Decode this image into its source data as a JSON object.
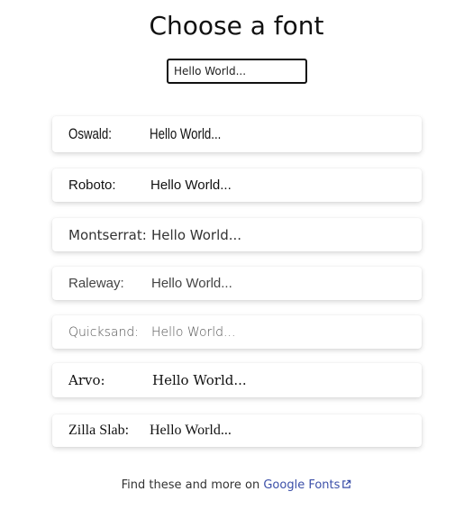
{
  "header": {
    "title": "Choose a font"
  },
  "preview_input": {
    "value": "Hello World..."
  },
  "fonts": [
    {
      "name": "Oswald:",
      "sample": "Hello World..."
    },
    {
      "name": "Roboto:",
      "sample": "Hello World..."
    },
    {
      "name": "Montserrat:",
      "sample": "Hello World..."
    },
    {
      "name": "Raleway:",
      "sample": "Hello World..."
    },
    {
      "name": "Quicksand:",
      "sample": "Hello World..."
    },
    {
      "name": "Arvo:",
      "sample": "Hello World..."
    },
    {
      "name": "Zilla Slab:",
      "sample": "Hello World..."
    }
  ],
  "footer": {
    "text": "Find these and more on",
    "link_text": "Google Fonts",
    "link_icon": "external-link-icon",
    "link_color": "#3b4fa8"
  }
}
